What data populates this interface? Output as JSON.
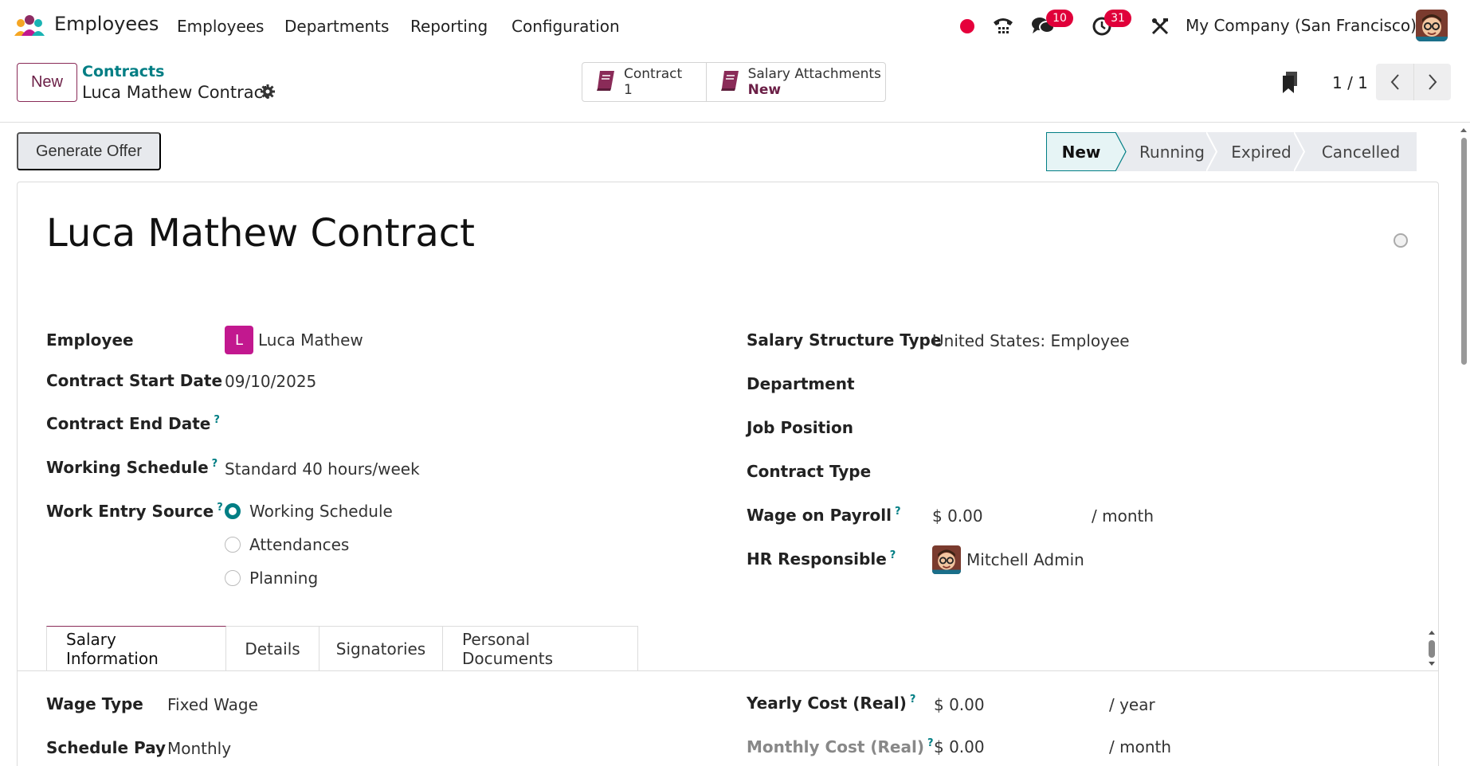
{
  "navbar": {
    "app_name": "Employees",
    "menu": [
      "Employees",
      "Departments",
      "Reporting",
      "Configuration"
    ],
    "messages_badge": "10",
    "activities_badge": "31",
    "company": "My Company (San Francisco)"
  },
  "control": {
    "new_label": "New",
    "breadcrumb_parent": "Contracts",
    "breadcrumb_current": "Luca Mathew Contract",
    "smart_buttons": [
      {
        "label": "Contract",
        "value": "1"
      },
      {
        "label": "Salary Attachments",
        "value": "New"
      }
    ],
    "pager": "1 / 1"
  },
  "header": {
    "generate_offer_label": "Generate Offer",
    "stages": [
      "New",
      "Running",
      "Expired",
      "Cancelled"
    ],
    "active_stage": "New"
  },
  "form": {
    "title": "Luca Mathew Contract",
    "left": {
      "employee_label": "Employee",
      "employee_initial": "L",
      "employee_value": "Luca Mathew",
      "start_label": "Contract Start Date",
      "start_value": "09/10/2025",
      "end_label": "Contract End Date",
      "schedule_label": "Working Schedule",
      "schedule_value": "Standard 40 hours/week",
      "source_label": "Work Entry Source",
      "source_options": [
        "Working Schedule",
        "Attendances",
        "Planning"
      ],
      "source_selected": "Working Schedule"
    },
    "right": {
      "structure_label": "Salary Structure Type",
      "structure_value": "United States: Employee",
      "department_label": "Department",
      "job_label": "Job Position",
      "contract_type_label": "Contract Type",
      "wage_label": "Wage on Payroll",
      "wage_value": "$ 0.00",
      "wage_unit": "/ month",
      "hr_label": "HR Responsible",
      "hr_value": "Mitchell Admin"
    },
    "help_mark": "?"
  },
  "tabs": [
    "Salary Information",
    "Details",
    "Signatories",
    "Personal Documents"
  ],
  "salary": {
    "wage_type_label": "Wage Type",
    "wage_type_value": "Fixed Wage",
    "schedule_pay_label": "Schedule Pay",
    "schedule_pay_value": "Monthly",
    "yearly_cost_label": "Yearly Cost (Real)",
    "yearly_cost_value": "$ 0.00",
    "yearly_cost_unit": "/ year",
    "monthly_cost_label": "Monthly Cost (Real)",
    "monthly_cost_value": "$ 0.00",
    "monthly_cost_unit": "/ month"
  }
}
